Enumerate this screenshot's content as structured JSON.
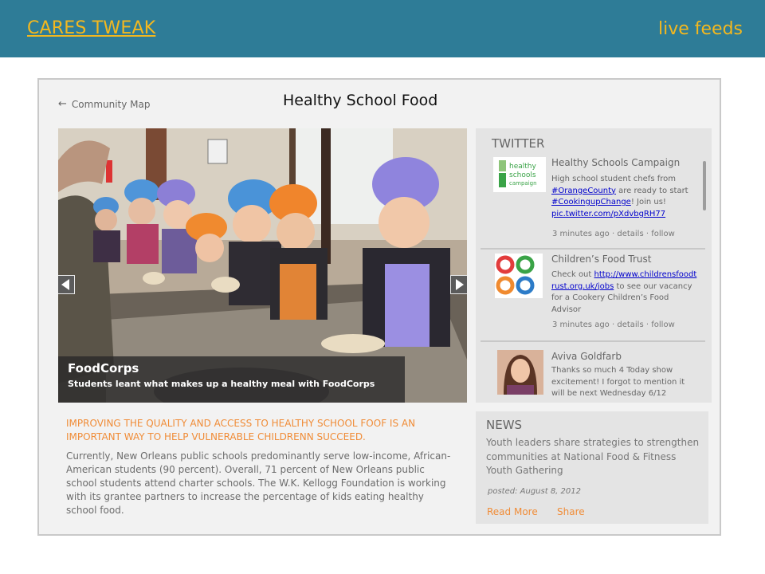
{
  "header": {
    "brand": "CARES TWEAK",
    "live_feeds": "live feeds",
    "background_color": "#2e7c97",
    "accent_color": "#f4b81e"
  },
  "page": {
    "back_link": "Community Map",
    "back_icon": "left-arrow-icon",
    "title": "Healthy School Food"
  },
  "hero": {
    "caption_title": "FoodCorps",
    "caption_subtitle": "Students leant what makes up a healthy meal with FoodCorps",
    "prev_icon": "chevron-left-icon",
    "next_icon": "chevron-right-icon"
  },
  "article": {
    "headline": "IMPROVING THE QUALITY AND ACCESS TO HEALTHY SCHOOL FOOF IS AN IMPORTANT WAY TO HELP VULNERABLE CHILDRENN SUCCEED.",
    "body": "Currently, New Orleans public schools predominantly serve low-income, African-American students (90 percent). Overall, 71 percent of New Orleans public school students attend charter schools. The W.K. Kellogg Foundation is working with its grantee partners to increase the percentage of kids eating healthy school food.",
    "headline_color": "#f08c37"
  },
  "twitter": {
    "heading": "TWITTER",
    "tweets": [
      {
        "name": "Healthy Schools Campaign",
        "avatar_text": [
          "healthy",
          "schools",
          "campaign"
        ],
        "parts": {
          "t1": "High school student chefs from ",
          "l1": "#OrangeCounty",
          "t2": " are ready to start ",
          "l2": "#CookingupChange",
          "t3": "! Join us! ",
          "l3": "pic.twitter.com/pXdvbgRH77"
        },
        "time": "3 minutes ago",
        "details": "details",
        "follow": "follow"
      },
      {
        "name": "Children’s Food Trust",
        "parts": {
          "t1": "Check out ",
          "l1": "http://www.childrensfoodtrust.org.uk/jobs",
          "t2": " to see our vacancy for a Cookery Children’s Food Advisor"
        },
        "time": "3 minutes ago",
        "details": "details",
        "follow": "follow"
      },
      {
        "name": "Aviva Goldfarb",
        "message": "Thanks so much 4 Today show excitement! I forgot to mention it will be next Wednesday 6/12"
      }
    ],
    "separator": "·"
  },
  "news": {
    "heading": "NEWS",
    "title": "Youth leaders share strategies to strengthen communities at National Food & Fitness Youth Gathering",
    "posted": "posted: August 8, 2012",
    "read_more": "Read More",
    "share": "Share"
  }
}
